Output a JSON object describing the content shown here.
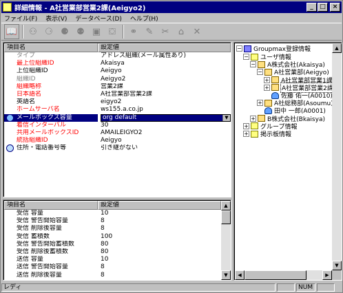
{
  "window": {
    "title": "詳細情報 - A社営業部営業2課(Aeigyo2)"
  },
  "titlebar_buttons": {
    "minimize": "_",
    "maximize": "□",
    "close": "×"
  },
  "menu": [
    "ファイル(F)",
    "表示(V)",
    "データベース(D)",
    "ヘルプ(H)"
  ],
  "toolbar": {
    "icons": [
      "open-book-icon",
      "org-split-icon",
      "org-merge-icon",
      "add-org-icon",
      "add-user-icon",
      "user-card-icon",
      "mailbox-icon",
      "link-icon",
      "pen-icon",
      "scissors-pen-icon",
      "lock-icon",
      "delete-x-icon"
    ]
  },
  "upper_table": {
    "columns": [
      "項目名",
      "設定値"
    ],
    "rows": [
      {
        "name": "タイプ",
        "value": "アドレス組織(メール属性あり)",
        "color": "#808080",
        "lead": ""
      },
      {
        "name": "最上位組織ID",
        "value": "Akaisya",
        "color": "#ff0000",
        "lead": ""
      },
      {
        "name": "上位組織ID",
        "value": "Aeigyo",
        "color": "#000000",
        "lead": ""
      },
      {
        "name": "組織ID",
        "value": "Aeigyo2",
        "color": "#808080",
        "lead": ""
      },
      {
        "name": "組織略称",
        "value": "営業2課",
        "color": "#ff0000",
        "lead": ""
      },
      {
        "name": "日本語名",
        "value": "A社営業部営業2課",
        "color": "#ff0000",
        "lead": ""
      },
      {
        "name": "英語名",
        "value": "eigyo2",
        "color": "#000000",
        "lead": ""
      },
      {
        "name": "ホームサーバ名",
        "value": "ws155.a.co.jp",
        "color": "#ff0000",
        "lead": ""
      },
      {
        "name": "メールボックス容量",
        "value": "org default",
        "color": "#ffffff",
        "lead": "mailbox",
        "selected": true
      },
      {
        "name": "着信インターバル",
        "value": "30",
        "color": "#ff0000",
        "lead": ""
      },
      {
        "name": "共用メールボックスID",
        "value": "AMAILEIGYO2",
        "color": "#ff0000",
        "lead": ""
      },
      {
        "name": "統括組織ID",
        "value": "Aeigyo",
        "color": "#ff0000",
        "lead": ""
      },
      {
        "name": "住所・電話番号等",
        "value": "引き継がない",
        "color": "#000000",
        "lead": "address"
      }
    ]
  },
  "lower_table": {
    "columns": [
      "項目名",
      "設定値"
    ],
    "rows": [
      {
        "name": "受信 容量",
        "value": "10"
      },
      {
        "name": "受信 警告開始容量",
        "value": "8"
      },
      {
        "name": "受信 削除後容量",
        "value": "8"
      },
      {
        "name": "受信 蓄積数",
        "value": "100"
      },
      {
        "name": "受信 警告開始蓄積数",
        "value": "80"
      },
      {
        "name": "受信 削除後蓄積数",
        "value": "80"
      },
      {
        "name": "送信 容量",
        "value": "10"
      },
      {
        "name": "送信 警告開始容量",
        "value": "8"
      },
      {
        "name": "送信 削除後容量",
        "value": "8"
      }
    ]
  },
  "tree": {
    "root": "Groupmax登録情報",
    "nodes": [
      {
        "label": "ユーザ情報",
        "pm": "−",
        "icon": "folder",
        "level": 1
      },
      {
        "label": "A株式会社(Akaisya)",
        "pm": "−",
        "icon": "org",
        "level": 2
      },
      {
        "label": "A社営業部(Aeigyo)",
        "pm": "−",
        "icon": "org",
        "level": 3
      },
      {
        "label": "A社営業部営業1課",
        "pm": "+",
        "icon": "org",
        "level": 4
      },
      {
        "label": "A社営業部営業2課",
        "pm": "+",
        "icon": "org",
        "level": 4,
        "highlight": true
      },
      {
        "label": "佐藤 佑一(A0010)",
        "pm": "",
        "icon": "user",
        "level": 4
      },
      {
        "label": "A社総務部(Asoumu)",
        "pm": "+",
        "icon": "org",
        "level": 3
      },
      {
        "label": "田中 一郎(A0001)",
        "pm": "",
        "icon": "user",
        "level": 3
      },
      {
        "label": "B株式会社(Bkaisya)",
        "pm": "+",
        "icon": "org",
        "level": 2
      },
      {
        "label": "グループ情報",
        "pm": "+",
        "icon": "folder",
        "level": 1
      },
      {
        "label": "掲示板情報",
        "pm": "+",
        "icon": "folder",
        "level": 1
      }
    ]
  },
  "status": {
    "text": "レディ",
    "num": "NUM"
  }
}
